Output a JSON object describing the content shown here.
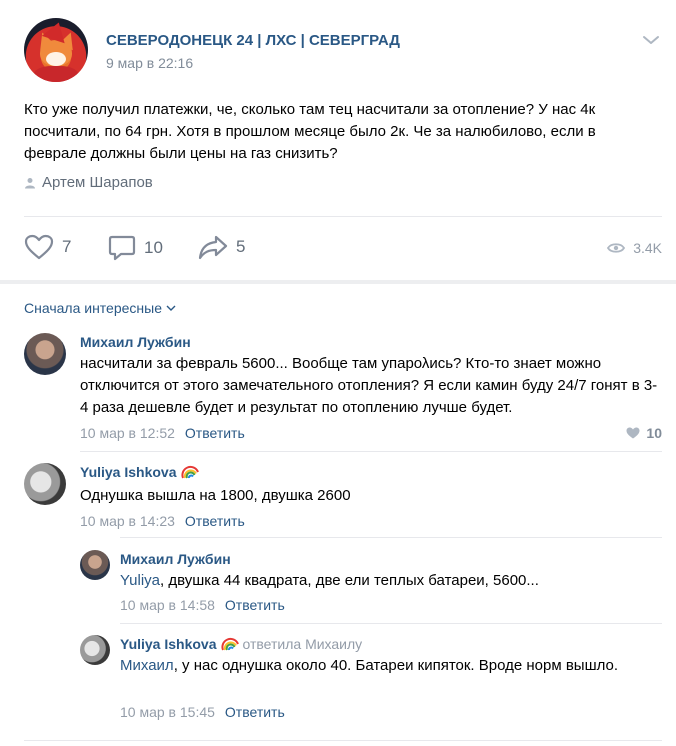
{
  "post": {
    "group_name": "СЕВЕРОДОНЕЦК 24 | ЛХС | СЕВЕРГРАД",
    "date": "9 мар в 22:16",
    "text": "Кто уже получил платежки, че, сколько там тец насчитали за отопление? У нас 4к посчитали, по 64 грн. Хотя в прошлом месяце было 2к. Че за налюбилово, если в феврале должны были цены на газ снизить?",
    "author": "Артем Шарапов",
    "likes": "7",
    "comments": "10",
    "shares": "5",
    "views": "3.4K"
  },
  "sort_label": "Сначала интересные",
  "comments": [
    {
      "name": "Михаил Лужбин",
      "text": "насчитали за февраль 5600... Вообще там упарολись? Кто-то знает можно отключится от этого замечательного отопления? Я если камин буду 24/7 гонят в 3-4 раза дешевле будет и результат по отоплению лучше будет.",
      "date": "10 мар в 12:52",
      "reply": "Ответить",
      "likes": "10"
    },
    {
      "name": "Yuliya Ishkova",
      "text": "Однушка вышла на 1800, двушка 2600",
      "date": "10 мар в 14:23",
      "reply": "Ответить"
    },
    {
      "name": "Михаил Лужбин",
      "mention": "Yuliya",
      "text": ", двушка 44 квадрата, две ели теплых батареи, 5600...",
      "date": "10 мар в 14:58",
      "reply": "Ответить"
    },
    {
      "name": "Yuliya Ishkova",
      "reply_to": "ответила Михаилу",
      "mention": "Михаил",
      "text": ", у нас однушка около 40. Батареи кипяток. Вроде норм вышло.",
      "date": "10 мар в 15:45",
      "reply": "Ответить"
    }
  ]
}
